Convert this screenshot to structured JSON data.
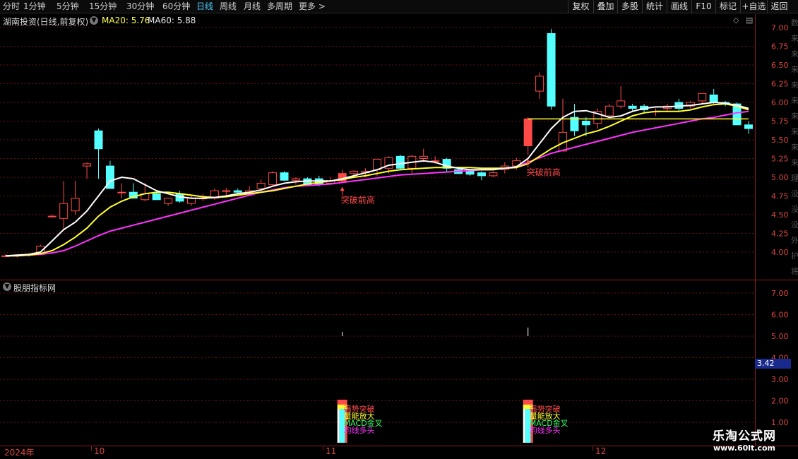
{
  "toolbar": {
    "periods": [
      "分时",
      "1分钟",
      "5分钟",
      "15分钟",
      "30分钟",
      "60分钟",
      "日线",
      "周线",
      "月线",
      "多周期",
      "更多"
    ],
    "active_period": "日线",
    "right_buttons": [
      "复权",
      "叠加",
      "多股",
      "统计",
      "画线",
      "F10",
      "标记",
      "+自选",
      "返回"
    ]
  },
  "header": {
    "stock_title": "湖南投资(日线,前复权)",
    "ma20": "MA20: 5.76",
    "ma60": "MA60: 5.88"
  },
  "indicator_panel": {
    "title": "股朋指标网",
    "current_value": "3.42",
    "signal_labels": [
      "强势突破",
      "量能放大",
      "MACD金叉",
      "均线多头"
    ]
  },
  "annotations": [
    "突破前高",
    "突破前高"
  ],
  "main_axis_ticks": [
    "7.00",
    "6.75",
    "6.50",
    "6.25",
    "6.00",
    "5.75",
    "5.50",
    "5.25",
    "5.00",
    "4.75",
    "4.50",
    "4.25",
    "4.00"
  ],
  "sub_axis_ticks": [
    "7.00",
    "6.00",
    "5.00",
    "4.00",
    "3.00",
    "2.00",
    "1.00"
  ],
  "x_axis": [
    "2024年",
    "10",
    "11",
    "12"
  ],
  "side_strip_chars": "数来来来来来来来来来理没没没外护将",
  "watermark": {
    "title": "乐淘公式网",
    "url": "www.60lt.com"
  },
  "colors": {
    "up": "#ff4a4a",
    "down": "#54ffff",
    "ma_white": "#ffffff",
    "ma_yellow": "#ffff30",
    "ma_magenta": "#ff33ff",
    "gridline": "#6b1010",
    "axis": "#d9473f"
  },
  "chart_data": {
    "type": "candlestick",
    "ylim": [
      3.8,
      7.1
    ],
    "candles": [
      {
        "o": 3.95,
        "h": 3.97,
        "l": 3.93,
        "c": 3.95
      },
      {
        "o": 3.95,
        "h": 3.97,
        "l": 3.93,
        "c": 3.96
      },
      {
        "o": 3.96,
        "h": 3.98,
        "l": 3.94,
        "c": 3.97
      },
      {
        "o": 3.97,
        "h": 4.1,
        "l": 3.96,
        "c": 4.08
      },
      {
        "o": 4.48,
        "h": 4.5,
        "l": 4.46,
        "c": 4.48
      },
      {
        "o": 4.45,
        "h": 4.95,
        "l": 4.3,
        "c": 4.65
      },
      {
        "o": 4.55,
        "h": 4.95,
        "l": 4.5,
        "c": 4.72
      },
      {
        "o": 5.15,
        "h": 5.2,
        "l": 4.98,
        "c": 5.18
      },
      {
        "o": 5.62,
        "h": 5.65,
        "l": 4.98,
        "c": 5.38
      },
      {
        "o": 5.15,
        "h": 5.22,
        "l": 4.85,
        "c": 4.85
      },
      {
        "o": 4.8,
        "h": 4.92,
        "l": 4.72,
        "c": 4.8
      },
      {
        "o": 4.8,
        "h": 4.92,
        "l": 4.72,
        "c": 4.72
      },
      {
        "o": 4.7,
        "h": 4.92,
        "l": 4.68,
        "c": 4.78
      },
      {
        "o": 4.78,
        "h": 4.8,
        "l": 4.7,
        "c": 4.7
      },
      {
        "o": 4.65,
        "h": 4.72,
        "l": 4.62,
        "c": 4.72
      },
      {
        "o": 4.78,
        "h": 4.82,
        "l": 4.66,
        "c": 4.68
      },
      {
        "o": 4.65,
        "h": 4.75,
        "l": 4.62,
        "c": 4.72
      },
      {
        "o": 4.72,
        "h": 4.78,
        "l": 4.68,
        "c": 4.72
      },
      {
        "o": 4.72,
        "h": 4.85,
        "l": 4.7,
        "c": 4.82
      },
      {
        "o": 4.82,
        "h": 4.86,
        "l": 4.75,
        "c": 4.82
      },
      {
        "o": 4.82,
        "h": 4.85,
        "l": 4.78,
        "c": 4.8
      },
      {
        "o": 4.8,
        "h": 4.88,
        "l": 4.76,
        "c": 4.82
      },
      {
        "o": 4.85,
        "h": 4.97,
        "l": 4.82,
        "c": 4.92
      },
      {
        "o": 4.9,
        "h": 5.08,
        "l": 4.88,
        "c": 5.06
      },
      {
        "o": 5.06,
        "h": 5.08,
        "l": 4.95,
        "c": 4.96
      },
      {
        "o": 4.96,
        "h": 5.0,
        "l": 4.9,
        "c": 4.98
      },
      {
        "o": 4.98,
        "h": 5.0,
        "l": 4.88,
        "c": 4.9
      },
      {
        "o": 4.98,
        "h": 5.02,
        "l": 4.88,
        "c": 4.9
      },
      {
        "o": 4.92,
        "h": 5.0,
        "l": 4.9,
        "c": 4.95
      },
      {
        "o": 4.95,
        "h": 5.1,
        "l": 4.93,
        "c": 5.05
      },
      {
        "o": 5.05,
        "h": 5.1,
        "l": 5.02,
        "c": 5.08
      },
      {
        "o": 5.06,
        "h": 5.12,
        "l": 5.0,
        "c": 5.08
      },
      {
        "o": 5.1,
        "h": 5.25,
        "l": 5.02,
        "c": 5.24
      },
      {
        "o": 5.12,
        "h": 5.28,
        "l": 5.05,
        "c": 5.26
      },
      {
        "o": 5.28,
        "h": 5.3,
        "l": 5.1,
        "c": 5.12
      },
      {
        "o": 5.12,
        "h": 5.3,
        "l": 5.05,
        "c": 5.28
      },
      {
        "o": 5.25,
        "h": 5.38,
        "l": 5.2,
        "c": 5.28
      },
      {
        "o": 5.22,
        "h": 5.28,
        "l": 5.18,
        "c": 5.22
      },
      {
        "o": 5.24,
        "h": 5.26,
        "l": 5.08,
        "c": 5.12
      },
      {
        "o": 5.1,
        "h": 5.12,
        "l": 5.04,
        "c": 5.05
      },
      {
        "o": 5.08,
        "h": 5.1,
        "l": 5.02,
        "c": 5.04
      },
      {
        "o": 5.06,
        "h": 5.08,
        "l": 4.96,
        "c": 5.02
      },
      {
        "o": 5.02,
        "h": 5.08,
        "l": 5.0,
        "c": 5.06
      },
      {
        "o": 5.1,
        "h": 5.2,
        "l": 5.05,
        "c": 5.15
      },
      {
        "o": 5.15,
        "h": 5.26,
        "l": 5.1,
        "c": 5.22
      },
      {
        "o": 5.42,
        "h": 5.8,
        "l": 5.3,
        "c": 5.78
      },
      {
        "o": 6.15,
        "h": 6.4,
        "l": 6.05,
        "c": 6.35
      },
      {
        "o": 6.92,
        "h": 6.98,
        "l": 5.9,
        "c": 5.95
      },
      {
        "o": 5.35,
        "h": 6.05,
        "l": 5.35,
        "c": 5.6
      },
      {
        "o": 5.8,
        "h": 5.98,
        "l": 5.55,
        "c": 5.62
      },
      {
        "o": 5.75,
        "h": 5.8,
        "l": 5.55,
        "c": 5.7
      },
      {
        "o": 5.72,
        "h": 5.92,
        "l": 5.65,
        "c": 5.88
      },
      {
        "o": 5.82,
        "h": 5.98,
        "l": 5.8,
        "c": 5.95
      },
      {
        "o": 5.95,
        "h": 6.22,
        "l": 5.92,
        "c": 6.02
      },
      {
        "o": 5.95,
        "h": 5.98,
        "l": 5.88,
        "c": 5.92
      },
      {
        "o": 5.95,
        "h": 5.98,
        "l": 5.85,
        "c": 5.9
      },
      {
        "o": 5.88,
        "h": 5.92,
        "l": 5.82,
        "c": 5.88
      },
      {
        "o": 5.92,
        "h": 5.98,
        "l": 5.88,
        "c": 5.95
      },
      {
        "o": 6.0,
        "h": 6.05,
        "l": 5.88,
        "c": 5.92
      },
      {
        "o": 5.95,
        "h": 6.02,
        "l": 5.92,
        "c": 6.0
      },
      {
        "o": 6.02,
        "h": 6.1,
        "l": 5.98,
        "c": 6.12
      },
      {
        "o": 6.1,
        "h": 6.18,
        "l": 5.98,
        "c": 6.0
      },
      {
        "o": 6.0,
        "h": 6.02,
        "l": 5.95,
        "c": 5.98
      },
      {
        "o": 5.98,
        "h": 6.0,
        "l": 5.7,
        "c": 5.7
      },
      {
        "o": 5.7,
        "h": 5.75,
        "l": 5.58,
        "c": 5.65
      }
    ],
    "ma_white": [
      3.95,
      3.96,
      3.97,
      4.0,
      4.15,
      4.3,
      4.4,
      4.55,
      4.75,
      4.95,
      5.0,
      4.98,
      4.9,
      4.82,
      4.78,
      4.74,
      4.72,
      4.72,
      4.73,
      4.75,
      4.78,
      4.8,
      4.83,
      4.88,
      4.92,
      4.94,
      4.95,
      4.95,
      4.95,
      4.98,
      5.02,
      5.06,
      5.1,
      5.16,
      5.18,
      5.2,
      5.22,
      5.2,
      5.15,
      5.12,
      5.1,
      5.1,
      5.1,
      5.12,
      5.14,
      5.25,
      5.45,
      5.65,
      5.8,
      5.88,
      5.89,
      5.85,
      5.8,
      5.82,
      5.88,
      5.92,
      5.94,
      5.94,
      5.95,
      5.96,
      5.98,
      6.0,
      5.99,
      5.96,
      5.92
    ],
    "ma_yellow": [
      3.95,
      3.95,
      3.96,
      3.98,
      4.02,
      4.1,
      4.2,
      4.32,
      4.48,
      4.6,
      4.68,
      4.74,
      4.78,
      4.8,
      4.8,
      4.78,
      4.76,
      4.74,
      4.73,
      4.74,
      4.76,
      4.78,
      4.8,
      4.82,
      4.85,
      4.88,
      4.91,
      4.93,
      4.95,
      4.97,
      5.0,
      5.02,
      5.05,
      5.08,
      5.1,
      5.11,
      5.12,
      5.13,
      5.13,
      5.13,
      5.13,
      5.12,
      5.12,
      5.12,
      5.13,
      5.18,
      5.28,
      5.38,
      5.46,
      5.52,
      5.58,
      5.62,
      5.68,
      5.75,
      5.82,
      5.86,
      5.88,
      5.88,
      5.88,
      5.9,
      5.94,
      5.97,
      5.98,
      5.95,
      5.9
    ],
    "ma_magenta": [
      3.95,
      3.95,
      3.96,
      3.97,
      3.99,
      4.02,
      4.08,
      4.15,
      4.22,
      4.28,
      4.32,
      4.36,
      4.4,
      4.44,
      4.48,
      4.52,
      4.56,
      4.6,
      4.64,
      4.68,
      4.72,
      4.76,
      4.8,
      4.83,
      4.86,
      4.88,
      4.89,
      4.9,
      4.91,
      4.93,
      4.95,
      4.97,
      4.99,
      5.01,
      5.03,
      5.04,
      5.05,
      5.06,
      5.07,
      5.08,
      5.09,
      5.1,
      5.11,
      5.12,
      5.14,
      5.2,
      5.26,
      5.32,
      5.36,
      5.4,
      5.44,
      5.48,
      5.52,
      5.56,
      5.6,
      5.63,
      5.66,
      5.69,
      5.72,
      5.75,
      5.78,
      5.8,
      5.83,
      5.86,
      5.88
    ],
    "resistance_line": 5.78,
    "breakout_candles": [
      29,
      45
    ],
    "sub_series": {
      "ylim": [
        0.5,
        7.5
      ],
      "spikes": [
        {
          "candle": 29,
          "low": 5.0,
          "high": 5.2
        },
        {
          "candle": 45,
          "low": 5.0,
          "high": 5.4
        }
      ]
    }
  }
}
